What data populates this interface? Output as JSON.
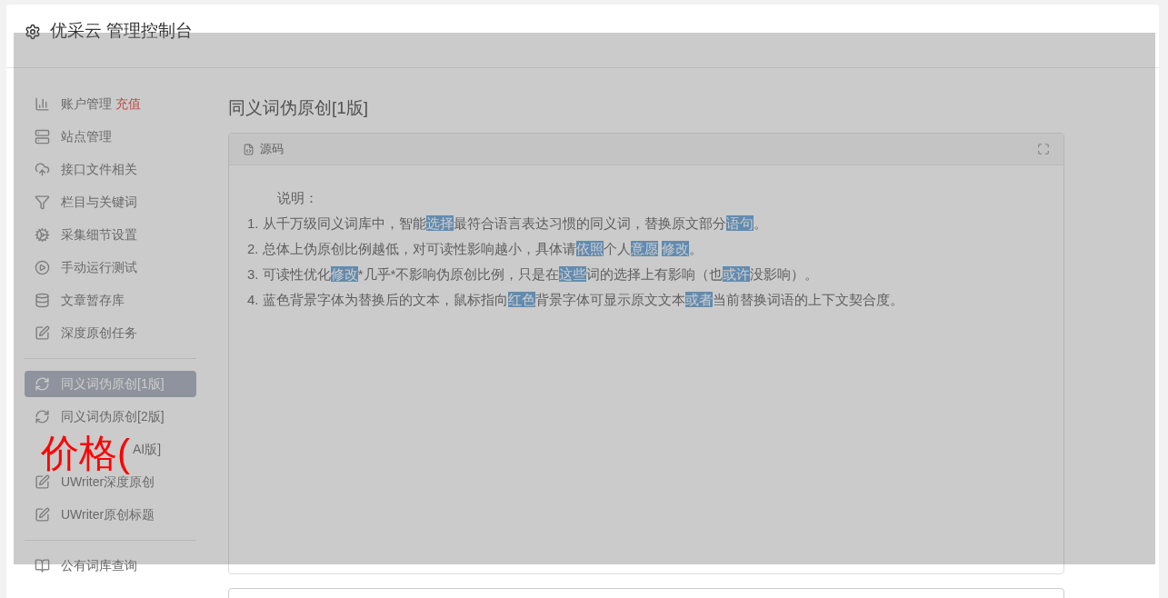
{
  "header": {
    "title": "优采云 管理控制台"
  },
  "sidebar": {
    "groups": [
      {
        "items": [
          {
            "label": "账户管理",
            "badge": "充值",
            "selected": false
          },
          {
            "label": "站点管理",
            "selected": false
          },
          {
            "label": "接口文件相关",
            "selected": false
          },
          {
            "label": "栏目与关键词",
            "selected": false
          },
          {
            "label": "采集细节设置",
            "selected": false
          },
          {
            "label": "手动运行测试",
            "selected": false
          },
          {
            "label": "文章暂存库",
            "selected": false
          },
          {
            "label": "深度原创任务",
            "selected": false
          }
        ]
      },
      {
        "items": [
          {
            "label": "同义词伪原创[1版]",
            "selected": true
          },
          {
            "label": "同义词伪原创[2版]",
            "selected": false
          },
          {
            "label": "AI版]",
            "covered": true,
            "selected": false
          },
          {
            "label": "UWriter深度原创",
            "selected": false
          },
          {
            "label": "UWriter原创标题",
            "selected": false
          }
        ]
      },
      {
        "items": [
          {
            "label": "公有词库查询",
            "selected": false
          }
        ]
      }
    ]
  },
  "main": {
    "title": "同义词伪原创[1版]",
    "panel": {
      "header": "源码",
      "intro": "说明：",
      "lines": [
        [
          {
            "text": "1. 从千万级同义词库中，智能",
            "highlighted": false
          },
          {
            "text": "选择",
            "highlighted": true
          },
          {
            "text": "最符合语言表达习惯的同义词，替换原文部分",
            "highlighted": false
          },
          {
            "text": "语句",
            "highlighted": true
          },
          {
            "text": "。",
            "highlighted": false
          }
        ],
        [
          {
            "text": "2. 总体上伪原创比例越低，对可读性影响越小，具体请",
            "highlighted": false
          },
          {
            "text": "依照",
            "highlighted": true
          },
          {
            "text": "个人",
            "highlighted": false
          },
          {
            "text": "意愿",
            "highlighted": true
          },
          {
            "text": "修改",
            "highlighted": true
          },
          {
            "text": "。",
            "highlighted": false
          }
        ],
        [
          {
            "text": "3. 可读性优化",
            "highlighted": false
          },
          {
            "text": "修改",
            "highlighted": true
          },
          {
            "text": "*几乎*不影响伪原创比例，只是在",
            "highlighted": false
          },
          {
            "text": "这些",
            "highlighted": true
          },
          {
            "text": "词的选择上有影响（也",
            "highlighted": false
          },
          {
            "text": "或许",
            "highlighted": true
          },
          {
            "text": "没影响）。",
            "highlighted": false
          }
        ],
        [
          {
            "text": "4. 蓝色背景字体为替换后的文本，鼠标指向",
            "highlighted": false
          },
          {
            "text": "红色",
            "highlighted": true
          },
          {
            "text": "背景字体可显示原文文本",
            "highlighted": false
          },
          {
            "text": "或者",
            "highlighted": true
          },
          {
            "text": "当前替换词语的上下文契合度。",
            "highlighted": false
          }
        ]
      ]
    }
  },
  "overlay_text": "价格("
}
